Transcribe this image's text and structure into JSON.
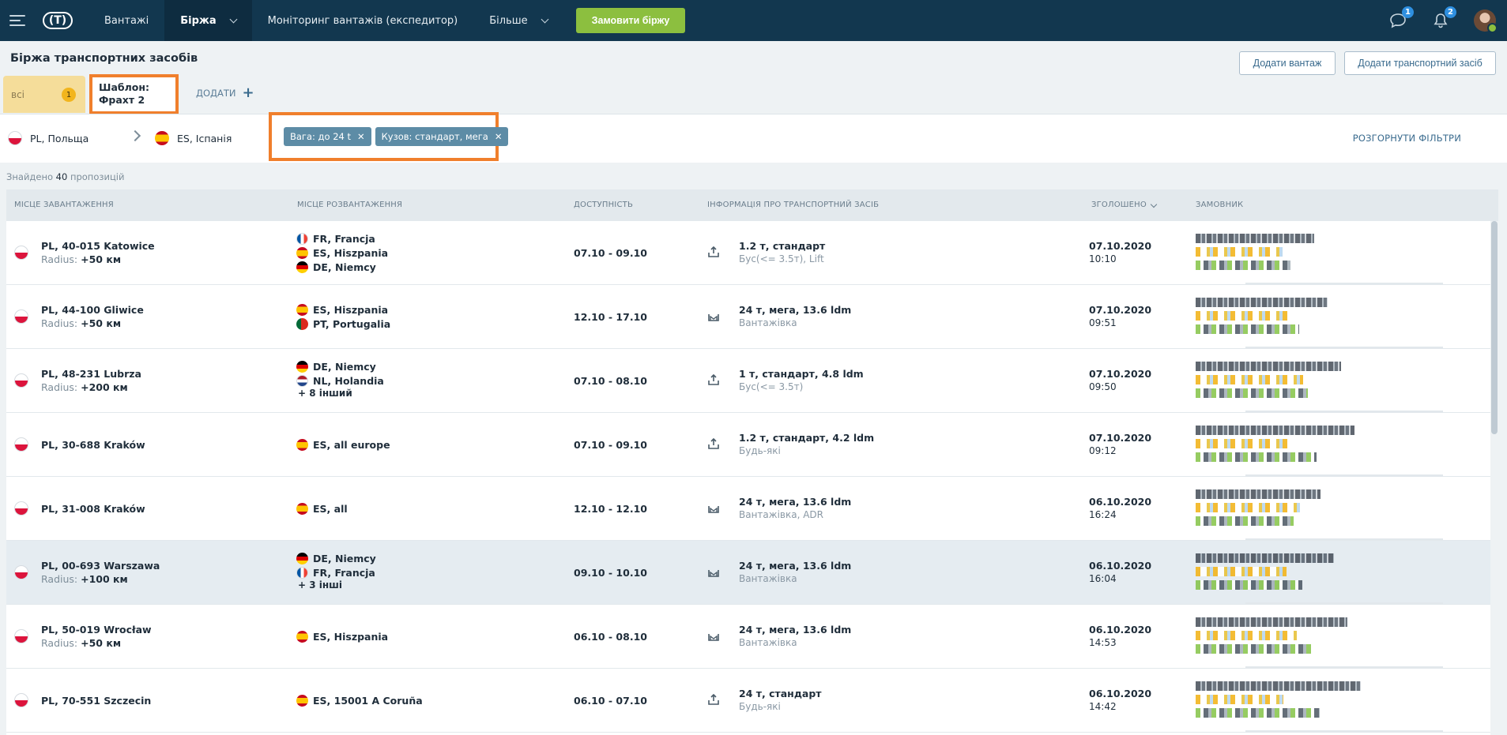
{
  "nav": {
    "items": [
      {
        "label": "Вантажі"
      },
      {
        "label": "Біржа"
      },
      {
        "label": "Моніторинг вантажів (експедитор)"
      },
      {
        "label": "Більше"
      }
    ],
    "order_button": "Замовити біржу",
    "messages_badge": "1",
    "notifications_badge": "2",
    "logo_text": "(T)"
  },
  "page": {
    "title": "Біржа транспортних засобів",
    "add_cargo_button": "Додати вантаж",
    "add_vehicle_button": "Додати транспортний засіб"
  },
  "tabs": {
    "all_label": "всі",
    "all_count": "1",
    "template_line1": "Шаблон:",
    "template_line2": "Фрахт 2",
    "add_label": "ДОДАТИ",
    "add_plus": "+"
  },
  "filters": {
    "from": "PL, Польща",
    "to": "ES, Іспанія",
    "chips": [
      {
        "label": "Вага: до 24 t"
      },
      {
        "label": "Кузов: стандарт, мега"
      }
    ],
    "expand_label": "РОЗГОРНУТИ ФІЛЬТРИ"
  },
  "results": {
    "prefix": "Знайдено",
    "count": "40",
    "suffix": "пропозицій"
  },
  "table": {
    "headers": {
      "loading": "Місце завантаження",
      "unloading": "Місце розвантаження",
      "availability": "Доступність",
      "vehicle": "Інформація про транспортний засіб",
      "announced": "Зголошено",
      "customer": "Замовник"
    },
    "radius_label": "Radius:",
    "rows": [
      {
        "from": "PL, 40-015 Katowice",
        "radius": "+50 км",
        "dest": [
          "FR, Francja",
          "ES, Hiszpania",
          "DE, Niemcy"
        ],
        "more": "",
        "avail": "07.10 - 09.10",
        "veh": "1.2 т, стандарт",
        "vsub": "Бус(<= 3.5т), Lift",
        "date": "07.10.2020",
        "time": "10:10"
      },
      {
        "from": "PL, 44-100 Gliwice",
        "radius": "+50 км",
        "dest": [
          "ES, Hiszpania",
          "PT, Portugalia"
        ],
        "more": "",
        "avail": "12.10 - 17.10",
        "veh": "24 т, мега, 13.6 ldm",
        "vsub": "Вантажівка",
        "date": "07.10.2020",
        "time": "09:51"
      },
      {
        "from": "PL, 48-231 Lubrza",
        "radius": "+200 км",
        "dest": [
          "DE, Niemcy",
          "NL, Holandia"
        ],
        "more": "+ 8 інший",
        "avail": "07.10 - 08.10",
        "veh": "1 т, стандарт, 4.8 ldm",
        "vsub": "Бус(<= 3.5т)",
        "date": "07.10.2020",
        "time": "09:50"
      },
      {
        "from": "PL, 30-688 Kraków",
        "radius": "",
        "dest": [
          "ES, all europe"
        ],
        "more": "",
        "avail": "07.10 - 09.10",
        "veh": "1.2 т, стандарт, 4.2 ldm",
        "vsub": "Будь-які",
        "date": "07.10.2020",
        "time": "09:12"
      },
      {
        "from": "PL, 31-008 Kraków",
        "radius": "",
        "dest": [
          "ES, all"
        ],
        "more": "",
        "avail": "12.10 - 12.10",
        "veh": "24 т, мега, 13.6 ldm",
        "vsub": "Вантажівка, ADR",
        "date": "06.10.2020",
        "time": "16:24"
      },
      {
        "from": "PL, 00-693 Warszawa",
        "radius": "+100 км",
        "dest": [
          "DE, Niemcy",
          "FR, Francja"
        ],
        "more": "+ 3 інші",
        "avail": "09.10 - 10.10",
        "veh": "24 т, мега, 13.6 ldm",
        "vsub": "Вантажівка",
        "date": "06.10.2020",
        "time": "16:04"
      },
      {
        "from": "PL, 50-019 Wrocław",
        "radius": "+50 км",
        "dest": [
          "ES, Hiszpania"
        ],
        "more": "",
        "avail": "06.10 - 08.10",
        "veh": "24 т, мега, 13.6 ldm",
        "vsub": "Вантажівка",
        "date": "06.10.2020",
        "time": "14:53"
      },
      {
        "from": "PL, 70-551 Szczecin",
        "radius": "",
        "dest": [
          "ES, 15001 A Coruña"
        ],
        "more": "",
        "avail": "06.10 - 07.10",
        "veh": "24 т, стандарт",
        "vsub": "Будь-які",
        "date": "06.10.2020",
        "time": "14:42"
      }
    ]
  }
}
